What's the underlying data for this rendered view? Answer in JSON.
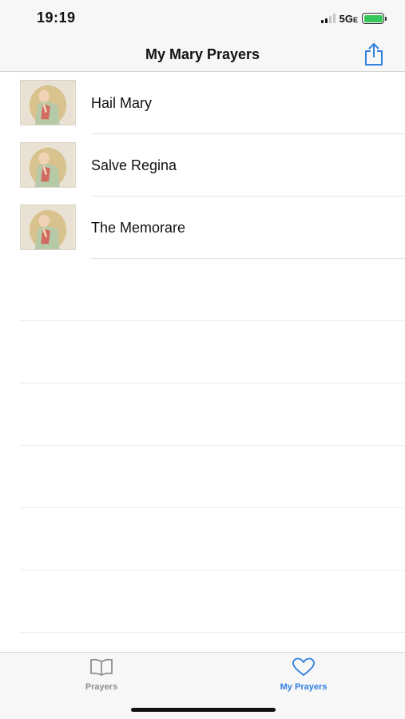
{
  "status_bar": {
    "time": "19:19",
    "network": "5G",
    "network_suffix": "E",
    "battery_color": "#35c759"
  },
  "nav": {
    "title": "My Mary Prayers",
    "share_icon": "share-icon"
  },
  "prayers": [
    {
      "label": "Hail Mary",
      "thumbnail": "mary-praying-image"
    },
    {
      "label": "Salve Regina",
      "thumbnail": "mary-praying-image"
    },
    {
      "label": "The Memorare",
      "thumbnail": "mary-praying-image"
    }
  ],
  "tab_bar": {
    "tabs": [
      {
        "label": "Prayers",
        "icon": "book-icon",
        "selected": false
      },
      {
        "label": "My Prayers",
        "icon": "heart-icon",
        "selected": true
      }
    ],
    "accent_color": "#2f7fe0",
    "inactive_color": "#8e8e93"
  }
}
